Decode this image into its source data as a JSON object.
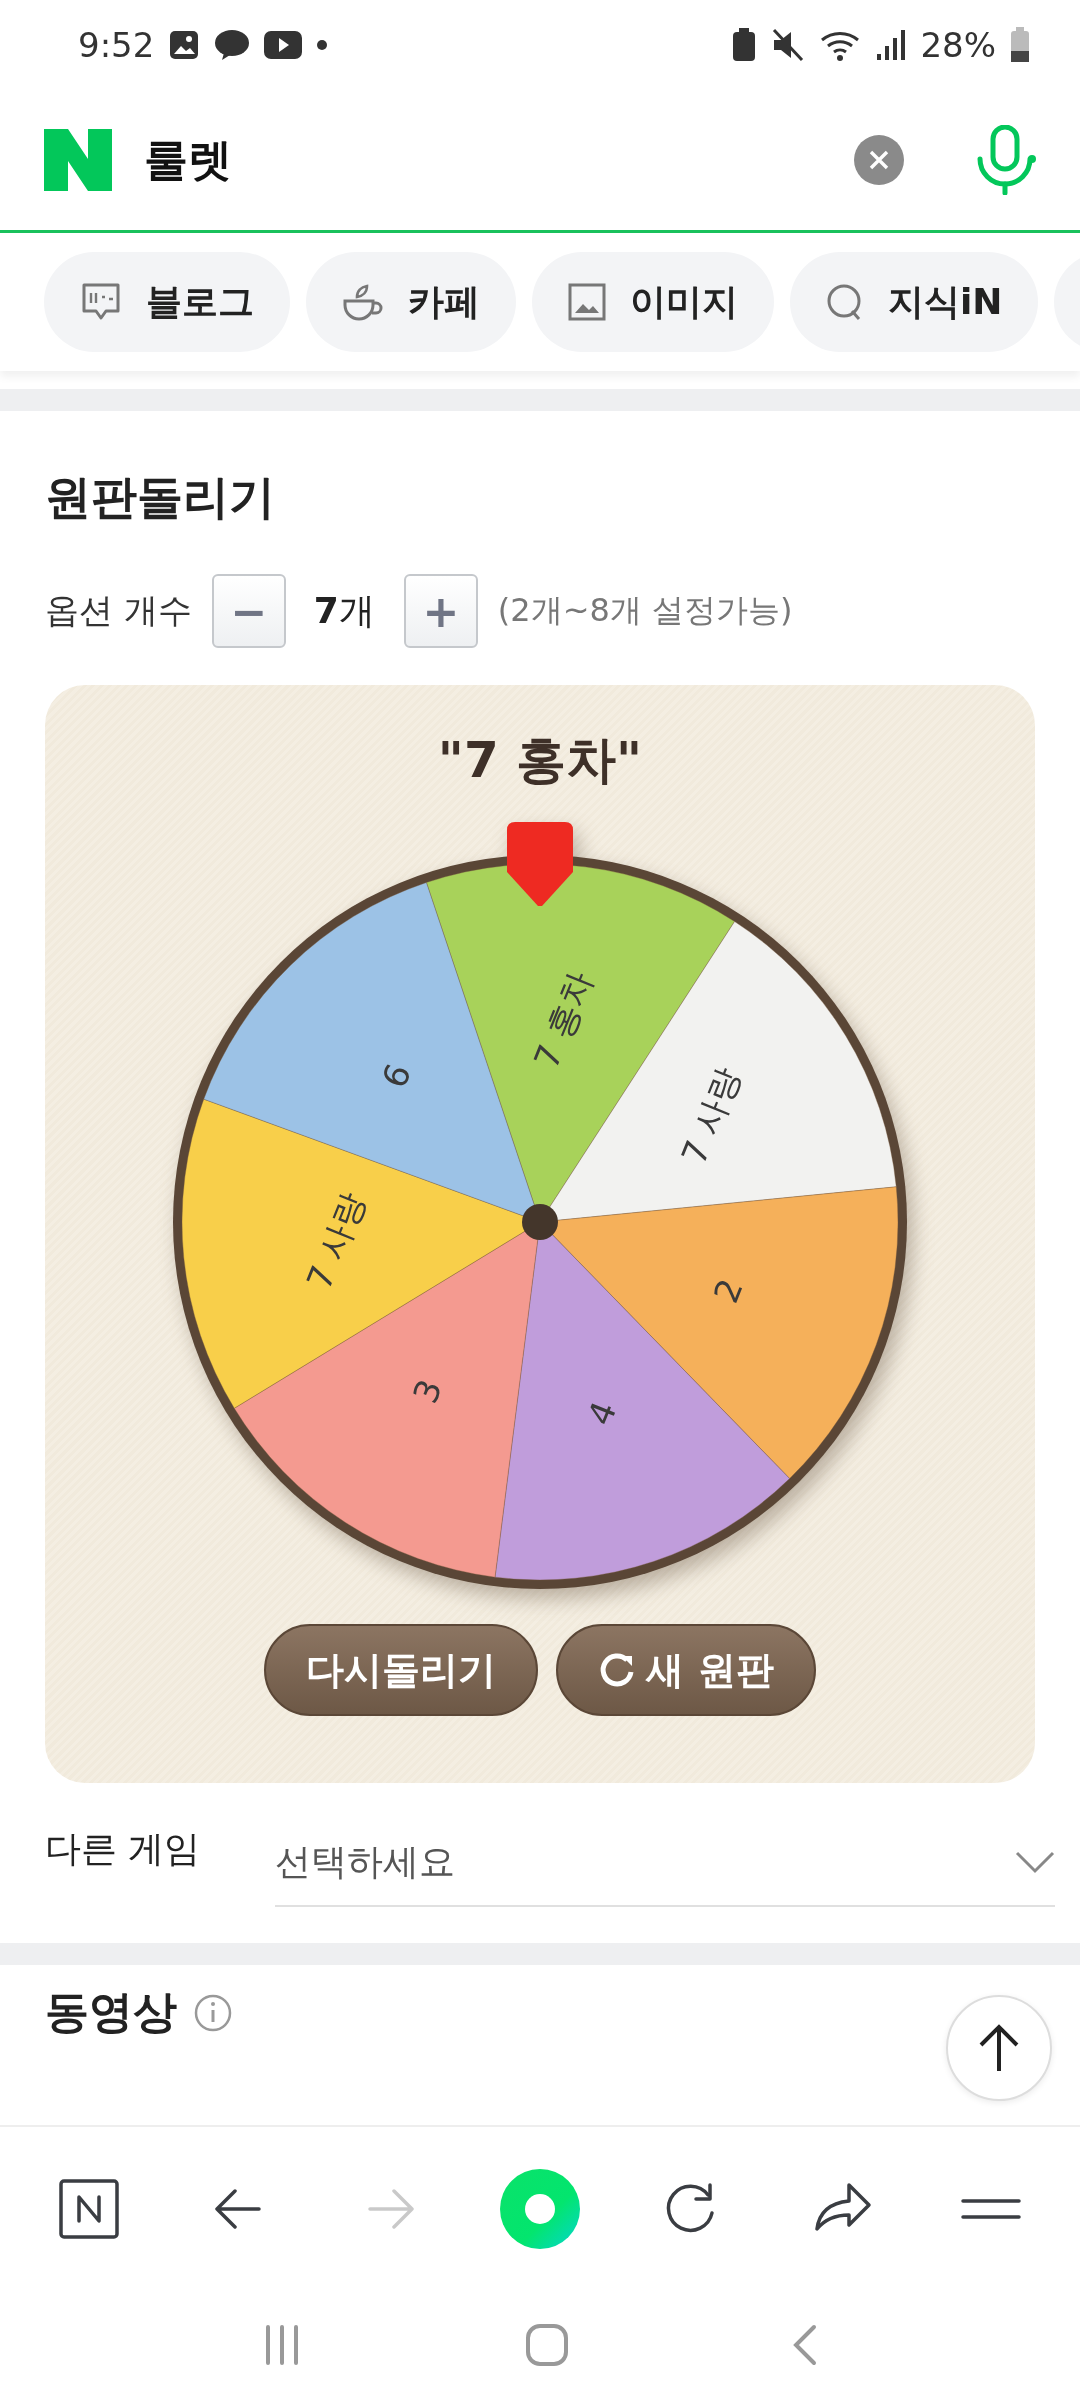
{
  "status_bar": {
    "time": "9:52",
    "battery": "28%"
  },
  "search": {
    "value": "룰렛"
  },
  "tabs": [
    {
      "label": "블로그",
      "kind": "blog"
    },
    {
      "label": "카페",
      "kind": "cafe"
    },
    {
      "label": "이미지",
      "kind": "image"
    },
    {
      "label": "지식iN",
      "kind": "qna"
    }
  ],
  "roulette": {
    "title": "원판돌리기",
    "option_label": "옵션 개수",
    "minus": "−",
    "count": "**7**개",
    "plus": "+",
    "hint": "(2개~8개 설정가능)",
    "result": "\"7 홍차\"",
    "segments": [
      {
        "label": "7 홍차",
        "color": "#a8d25a"
      },
      {
        "label": "7 사랑",
        "color": "#f2f2f0"
      },
      {
        "label": "2",
        "color": "#f5b05a"
      },
      {
        "label": "4",
        "color": "#c09ddb"
      },
      {
        "label": "3",
        "color": "#f49a90"
      },
      {
        "label": "7 사랑",
        "color": "#f8cf4a"
      },
      {
        "label": "6",
        "color": "#9cc2e6"
      }
    ],
    "buttons": [
      {
        "label": "다시돌리기",
        "kind": "spin"
      },
      {
        "label": "새 원판",
        "kind": "new"
      }
    ],
    "other_label": "다른 게임",
    "other_placeholder": "선택하세요"
  },
  "next_section": {
    "title": "동영상"
  },
  "bottom_bar": [
    {
      "kind": "home",
      "disabled": false
    },
    {
      "kind": "back",
      "disabled": false
    },
    {
      "kind": "forward",
      "disabled": true
    },
    {
      "kind": "green",
      "disabled": false
    },
    {
      "kind": "reload",
      "disabled": false
    },
    {
      "kind": "share",
      "disabled": false
    },
    {
      "kind": "menu",
      "disabled": false
    }
  ]
}
